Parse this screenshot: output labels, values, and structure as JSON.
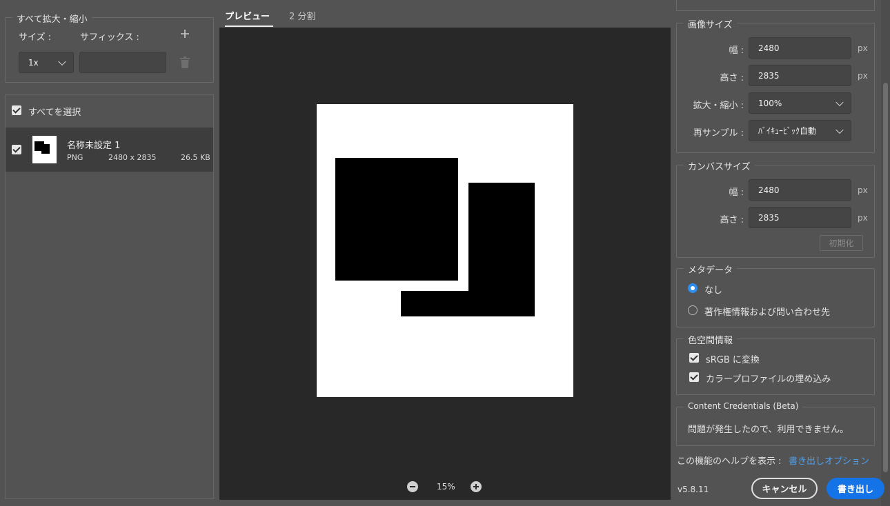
{
  "left_panel": {
    "scale_all": {
      "title": "すべて拡大・縮小",
      "size_label": "サイズ :",
      "suffix_label": "サフィックス :",
      "size_value": "1x",
      "suffix_value": ""
    },
    "select_all_label": "すべてを選択",
    "asset": {
      "name": "名称未設定 1",
      "format": "PNG",
      "dimensions": "2480 x 2835",
      "filesize": "26.5 KB"
    }
  },
  "preview": {
    "tabs": [
      {
        "label": "プレビュー",
        "active": true
      },
      {
        "label": "2 分割",
        "active": false
      }
    ],
    "zoom": "15%"
  },
  "right_panel": {
    "image_size": {
      "title": "画像サイズ",
      "width_label": "幅 :",
      "width_value": "2480",
      "height_label": "高さ :",
      "height_value": "2835",
      "unit": "px",
      "scale_label": "拡大・縮小 :",
      "scale_value": "100%",
      "resample_label": "再サンプル :",
      "resample_value": "ﾊﾞｲｷｭｰﾋﾞｯｸ自動"
    },
    "canvas_size": {
      "title": "カンバスサイズ",
      "width_label": "幅 :",
      "width_value": "2480",
      "height_label": "高さ :",
      "height_value": "2835",
      "unit": "px",
      "reset_label": "初期化"
    },
    "metadata": {
      "title": "メタデータ",
      "options": [
        "なし",
        "著作権情報および問い合わせ先"
      ],
      "selected": "なし"
    },
    "color_space": {
      "title": "色空間情報",
      "srgb_label": "sRGB に変換",
      "profile_label": "カラープロファイルの埋め込み"
    },
    "content_credentials": {
      "title": "Content Credentials (Beta)",
      "message": "問題が発生したので、利用できません。"
    },
    "help_prefix": "この機能のヘルプを表示 :",
    "help_link": "書き出しオプション"
  },
  "footer": {
    "version": "v5.8.11",
    "cancel_label": "キャンセル",
    "export_label": "書き出し"
  },
  "colors": {
    "accent": "#1473e6",
    "link": "#4ba1f5",
    "preview_bg": "#282828",
    "panel_bg": "#535353"
  }
}
